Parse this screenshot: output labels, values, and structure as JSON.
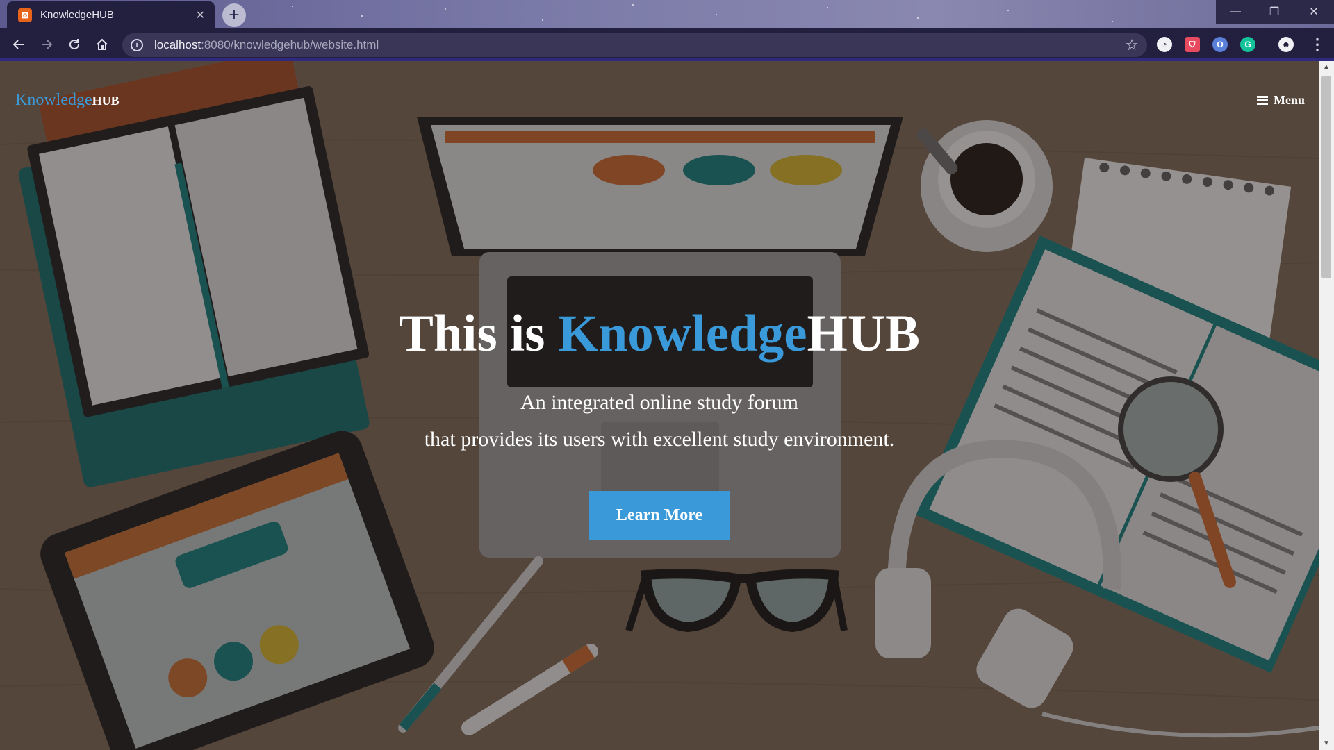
{
  "browser": {
    "tab_title": "KnowledgeHUB",
    "tab_favicon": "xampp-icon",
    "new_tab_label": "+",
    "url_host": "localhost",
    "url_path": ":8080/knowledgehub/website.html",
    "window_controls": {
      "minimize": "—",
      "maximize": "❐",
      "close": "✕"
    }
  },
  "site": {
    "brand_accent": "Knowledge",
    "brand_rest": "HUB",
    "menu_label": "Menu"
  },
  "hero": {
    "title_prefix": "This is ",
    "title_accent": "Knowledge",
    "title_suffix": "HUB",
    "subtitle_line1": "An integrated online study forum",
    "subtitle_line2": "that provides its users with excellent study environment.",
    "cta_label": "Learn More"
  },
  "colors": {
    "accent": "#3a9ad9",
    "browser_frame": "#23203f"
  }
}
